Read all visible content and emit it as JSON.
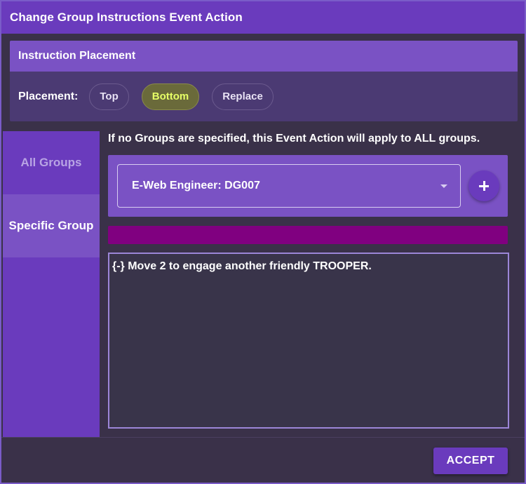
{
  "dialog": {
    "title": "Change Group Instructions Event Action"
  },
  "placement": {
    "header": "Instruction Placement",
    "label": "Placement:",
    "options": [
      "Top",
      "Bottom",
      "Replace"
    ],
    "selected": "Bottom"
  },
  "tabs": {
    "items": [
      "All Groups",
      "Specific Group"
    ],
    "active": "Specific Group"
  },
  "content": {
    "info_text": "If no Groups are specified, this Event Action will apply to ALL groups.",
    "group_select_value": "E-Web Engineer: DG007",
    "add_icon": "plus-icon",
    "group_color": "#800080",
    "instruction_text": "{-} Move 2 to engage another friendly TROOPER."
  },
  "footer": {
    "accept_label": "ACCEPT"
  },
  "colors": {
    "titlebar": "#6a3bbd",
    "accent": "#7a52c4",
    "selected_chip_text": "#e6ff66"
  }
}
